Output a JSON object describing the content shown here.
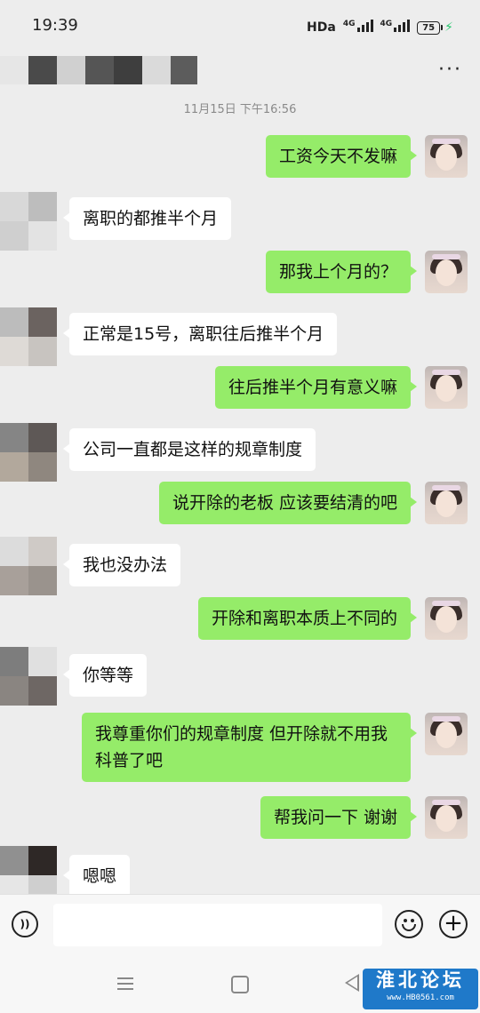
{
  "status": {
    "time": "19:39",
    "hd": "HDa",
    "net1": "4G",
    "net2": "4G",
    "battery": "75"
  },
  "header": {
    "more_label": "···"
  },
  "timestamp": "11月15日 下午16:56",
  "messages": [
    {
      "side": "out",
      "text": "工资今天不发嘛"
    },
    {
      "side": "in",
      "text": "离职的都推半个月"
    },
    {
      "side": "out",
      "text": "那我上个月的？"
    },
    {
      "side": "in",
      "text": "正常是15号，离职往后推半个月"
    },
    {
      "side": "out",
      "text": "往后推半个月有意义嘛"
    },
    {
      "side": "in",
      "text": "公司一直都是这样的规章制度"
    },
    {
      "side": "out",
      "text": "说开除的老板 应该要结清的吧"
    },
    {
      "side": "in",
      "text": "我也没办法"
    },
    {
      "side": "out",
      "text": "开除和离职本质上不同的"
    },
    {
      "side": "in",
      "text": "你等等"
    },
    {
      "side": "out",
      "text": "我尊重你们的规章制度 但开除就不用我科普了吧"
    },
    {
      "side": "out",
      "text": "帮我问一下 谢谢"
    },
    {
      "side": "in",
      "text": "嗯嗯"
    }
  ],
  "input": {
    "voice_label": "))",
    "placeholder": "",
    "plus_label": "+"
  },
  "watermark": {
    "title": "淮北论坛",
    "url": "www.HB0561.com"
  },
  "colors": {
    "outgoing_bubble": "#95ec69",
    "incoming_bubble": "#ffffff",
    "background": "#ededed"
  }
}
